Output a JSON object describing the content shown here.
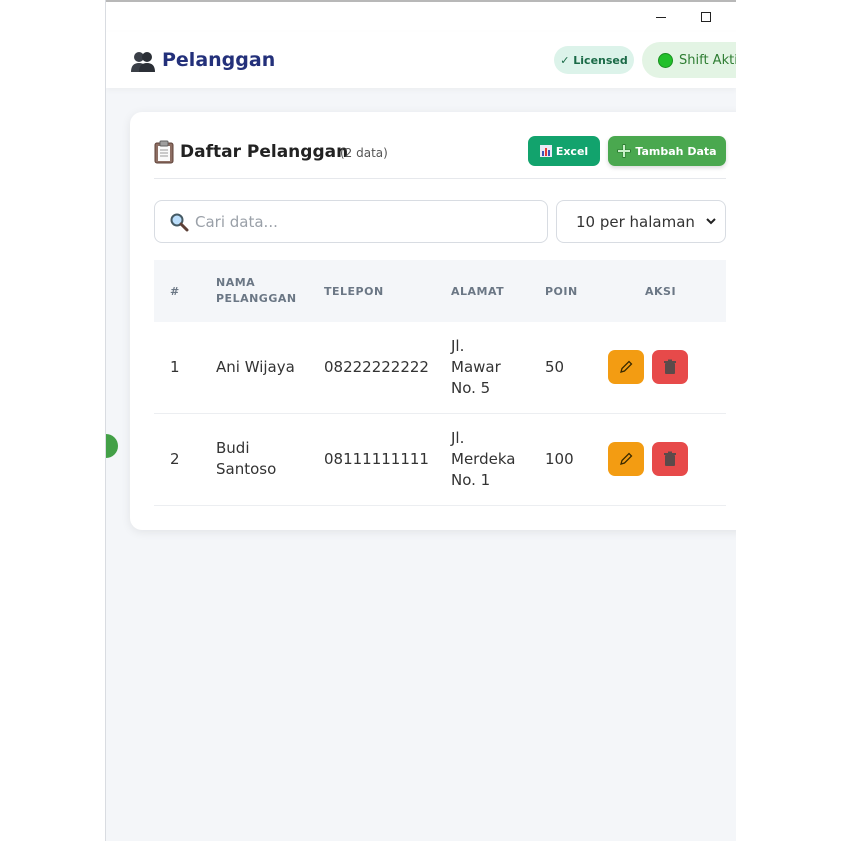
{
  "window": {
    "minimize_glyph": "—",
    "maximize_glyph": "☐"
  },
  "header": {
    "icon": "users-icon",
    "title": "Pelanggan",
    "license_badge": "✓ Licensed",
    "shift_badge": "Shift Aktif",
    "colors": {
      "title": "#23307a",
      "license_bg": "#dcf3ea",
      "shift_bg": "#e3f4e4",
      "shift_dot": "#22c02b"
    }
  },
  "card": {
    "icon": "clipboard-icon",
    "title": "Daftar Pelanggan",
    "count": "(2 data)",
    "excel_button": "Excel",
    "add_button": "Tambah Data",
    "colors": {
      "excel": "#12a36d",
      "add": "#4aa84f"
    }
  },
  "search": {
    "placeholder": "Cari data...",
    "value": ""
  },
  "per_page": {
    "selected": "10 per halaman"
  },
  "table": {
    "columns": [
      "#",
      "NAMA\nPELANGGAN",
      "TELEPON",
      "ALAMAT",
      "POIN",
      "AKSI"
    ],
    "rows": [
      {
        "no": "1",
        "nama": "Ani Wijaya",
        "telepon": "08222222222",
        "alamat": "Jl.\nMawar\nNo. 5",
        "poin": "50"
      },
      {
        "no": "2",
        "nama": "Budi\nSantoso",
        "telepon": "08111111111",
        "alamat": "Jl.\nMerdeka\nNo. 1",
        "poin": "100"
      }
    ],
    "action_colors": {
      "edit": "#f39c12",
      "delete": "#e74a4a"
    }
  }
}
